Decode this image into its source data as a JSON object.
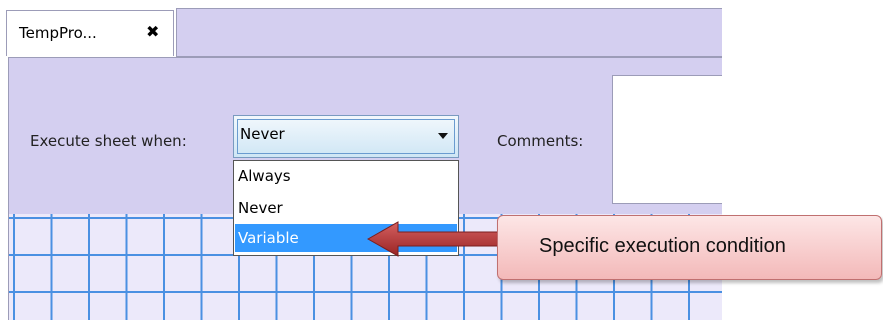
{
  "tab": {
    "title": "TempPro...",
    "close_symbol": "✖"
  },
  "settings": {
    "execute_label": "Execute sheet when:",
    "comments_label": "Comments:",
    "comments_value": ""
  },
  "combo": {
    "selected": "Never",
    "options": [
      "Always",
      "Never",
      "Variable"
    ],
    "highlighted": "Variable",
    "arrow_icon": "chevron-down-icon"
  },
  "callout": {
    "text": "Specific execution condition",
    "arrow_icon": "arrow-left-icon"
  },
  "colors": {
    "panel_bg": "#d4cff0",
    "grid_line": "#4a90e2",
    "grid_bg": "#ece9fa",
    "highlight": "#3399ff",
    "callout_fill": "#f3b9b9",
    "arrow_fill": "#b03030"
  }
}
